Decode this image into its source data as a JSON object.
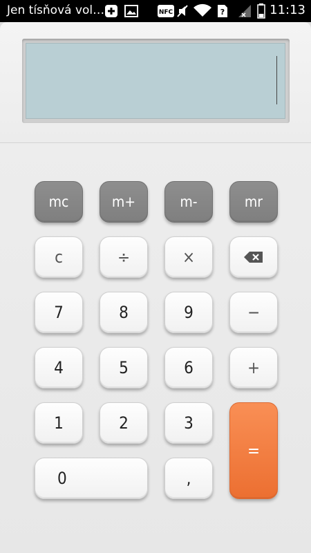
{
  "status_bar": {
    "notification_text": "Jen tísňová vol…",
    "time": "11:13",
    "icons": [
      "plus-icon",
      "image-icon",
      "nfc-icon",
      "mute-icon",
      "wifi-icon",
      "sim-unknown-icon",
      "signal-icon",
      "battery-icon"
    ],
    "nfc_label": "NFC"
  },
  "display": {
    "value": ""
  },
  "keys": {
    "mc": "mc",
    "m_plus": "m+",
    "m_minus": "m-",
    "mr": "mr",
    "clear": "c",
    "divide": "÷",
    "multiply": "×",
    "seven": "7",
    "eight": "8",
    "nine": "9",
    "minus": "−",
    "four": "4",
    "five": "5",
    "six": "6",
    "plus": "+",
    "one": "1",
    "two": "2",
    "three": "3",
    "equals": "=",
    "zero": "0",
    "decimal": ","
  },
  "colors": {
    "display_bg": "#b9cfd4",
    "memory_key": "#888888",
    "equals_key": "#f47f44"
  }
}
